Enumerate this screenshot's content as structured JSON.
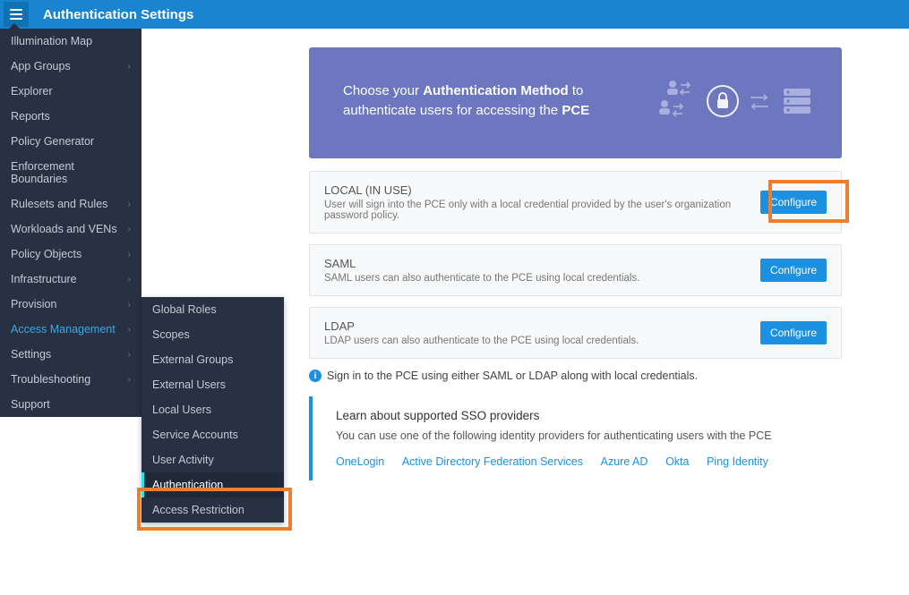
{
  "header": {
    "title": "Authentication Settings"
  },
  "sidebar": {
    "items": [
      {
        "label": "Illumination Map",
        "caret": false
      },
      {
        "label": "App Groups",
        "caret": true
      },
      {
        "label": "Explorer",
        "caret": false
      },
      {
        "label": "Reports",
        "caret": false
      },
      {
        "label": "Policy Generator",
        "caret": false
      },
      {
        "label": "Enforcement Boundaries",
        "caret": false
      },
      {
        "label": "Rulesets and Rules",
        "caret": true
      },
      {
        "label": "Workloads and VENs",
        "caret": true
      },
      {
        "label": "Policy Objects",
        "caret": true
      },
      {
        "label": "Infrastructure",
        "caret": true
      },
      {
        "label": "Provision",
        "caret": true
      },
      {
        "label": "Access Management",
        "caret": true,
        "active": true
      },
      {
        "label": "Settings",
        "caret": true
      },
      {
        "label": "Troubleshooting",
        "caret": true
      },
      {
        "label": "Support",
        "caret": false
      }
    ]
  },
  "submenu": {
    "items": [
      {
        "label": "Global Roles"
      },
      {
        "label": "Scopes"
      },
      {
        "label": "External Groups"
      },
      {
        "label": "External Users"
      },
      {
        "label": "Local Users"
      },
      {
        "label": "Service Accounts"
      },
      {
        "label": "User Activity"
      },
      {
        "label": "Authentication",
        "selected": true
      },
      {
        "label": "Access Restriction"
      }
    ]
  },
  "banner": {
    "prefix": "Choose your ",
    "bold1": "Authentication Method",
    "mid": " to authenticate users for accessing the ",
    "bold2": "PCE"
  },
  "cards": [
    {
      "title": "LOCAL (IN USE)",
      "desc": "User will sign into the PCE only with a local credential provided by the user's organization password policy.",
      "button": "Configure"
    },
    {
      "title": "SAML",
      "desc": "SAML users can also authenticate to the PCE using local credentials.",
      "button": "Configure"
    },
    {
      "title": "LDAP",
      "desc": "LDAP users can also authenticate to the PCE using local credentials.",
      "button": "Configure"
    }
  ],
  "info": "Sign in to the PCE using either SAML or LDAP along with local credentials.",
  "sso": {
    "title": "Learn about supported SSO providers",
    "desc": "You can use one of the following identity providers for authenticating users with the PCE",
    "links": [
      "OneLogin",
      "Active Directory Federation Services",
      "Azure AD",
      "Okta",
      "Ping Identity"
    ]
  }
}
